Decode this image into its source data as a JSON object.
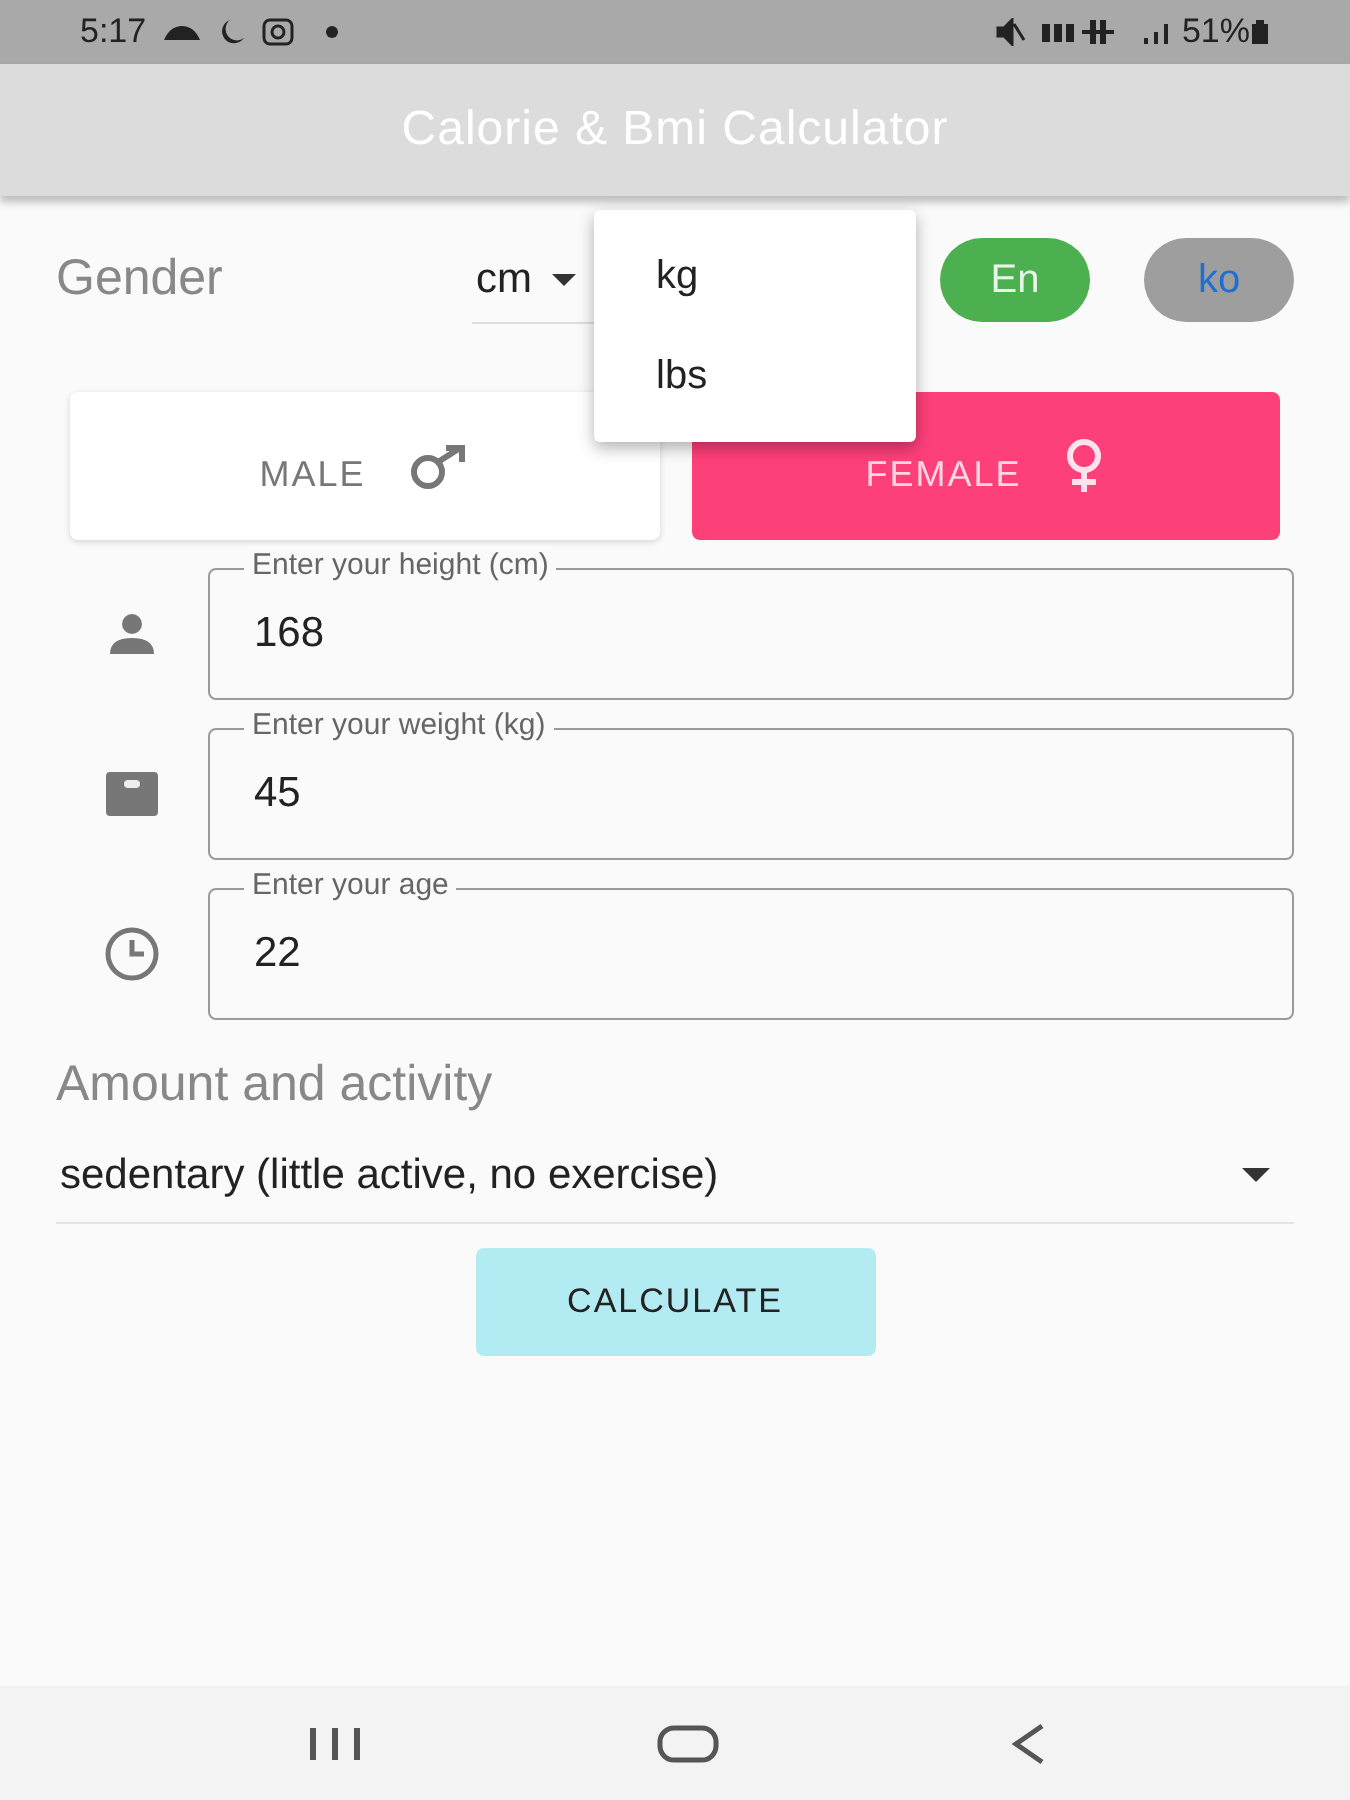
{
  "status_bar": {
    "time": "5:17",
    "battery": "51%"
  },
  "app_bar": {
    "title": "Calorie & Bmi Calculator"
  },
  "gender_label": "Gender",
  "unit_dropdown": {
    "value": "cm"
  },
  "unit_menu": {
    "items": [
      {
        "label": "kg"
      },
      {
        "label": "lbs"
      }
    ]
  },
  "language_buttons": [
    {
      "label": "En",
      "selected": true
    },
    {
      "label": "ko",
      "selected": false
    }
  ],
  "gender_buttons": [
    {
      "label": "MALE",
      "kind": "male",
      "selected": false
    },
    {
      "label": "FEMALE",
      "kind": "female",
      "selected": true
    }
  ],
  "fields": [
    {
      "kind": "height",
      "label": "Enter your height (cm)",
      "value": "168"
    },
    {
      "kind": "weight",
      "label": "Enter your weight (kg)",
      "value": "45"
    },
    {
      "kind": "age",
      "label": "Enter your age",
      "value": "22"
    }
  ],
  "activity": {
    "label": "Amount and activity",
    "value": "sedentary (little active, no exercise)"
  },
  "calculate_button": "CALCULATE"
}
